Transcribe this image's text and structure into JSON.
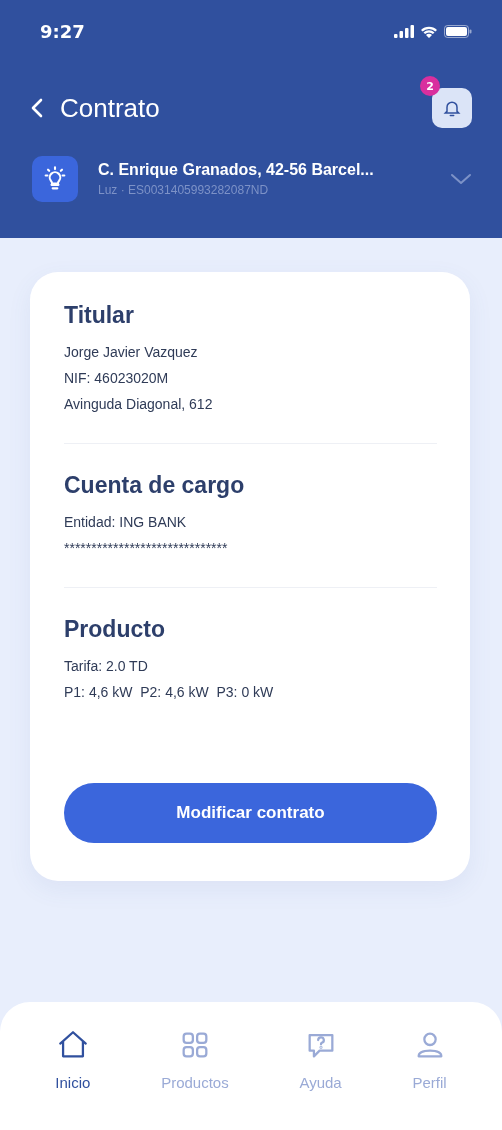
{
  "status_bar": {
    "time": "9:27"
  },
  "header": {
    "title": "Contrato",
    "notifications": "2"
  },
  "supply": {
    "address": "C. Enrique Granados, 42-56 Barcel...",
    "detail": "Luz · ES0031405993282087ND"
  },
  "sections": [
    {
      "title": "Titular",
      "lines": [
        "Jorge Javier Vazquez",
        "NIF: 46023020M",
        "Avinguda Diagonal, 612"
      ]
    },
    {
      "title": "Cuenta de cargo",
      "lines": [
        "Entidad: ING BANK",
        "******************************"
      ]
    },
    {
      "title": "Producto",
      "lines": [
        "Tarifa: 2.0 TD",
        "P1: 4,6 kW  P2: 4,6 kW  P3: 0 kW"
      ]
    }
  ],
  "action_button": "Modificar contrato",
  "nav": [
    {
      "label": "Inicio",
      "selected": true
    },
    {
      "label": "Productos",
      "selected": false
    },
    {
      "label": "Ayuda",
      "selected": false
    },
    {
      "label": "Perfil",
      "selected": false
    }
  ]
}
